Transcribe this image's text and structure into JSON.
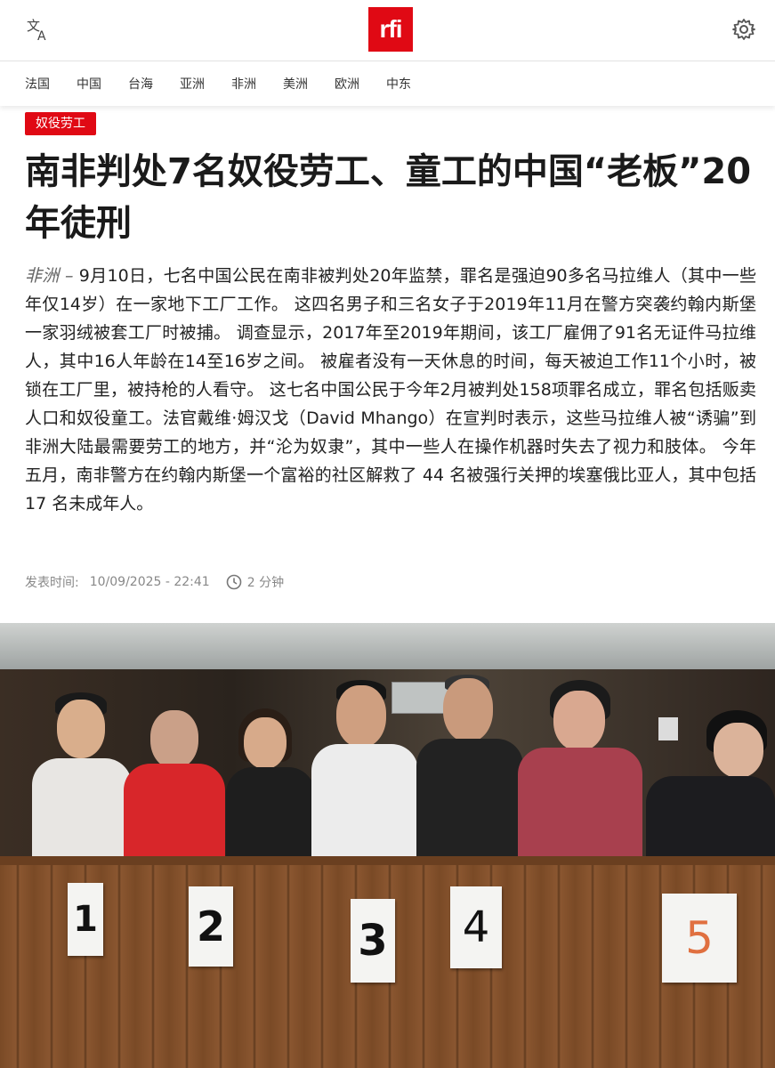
{
  "header": {
    "translate_icon": "translate-icon",
    "logo_text": "rfi",
    "settings_icon": "gear-icon"
  },
  "nav": {
    "items": [
      "法国",
      "中国",
      "台海",
      "亚洲",
      "非洲",
      "美洲",
      "欧洲",
      "中东"
    ]
  },
  "article": {
    "tag": "奴役劳工",
    "title": "南非判处7名奴役劳工、童工的中国“老板”20年徒刑",
    "region": "非洲",
    "region_sep": " – ",
    "lead": "9月10日，七名中国公民在南非被判处20年监禁，罪名是强迫90多名马拉维人（其中一些年仅14岁）在一家地下工厂工作。 这四名男子和三名女子于2019年11月在警方突袭约翰内斯堡一家羽绒被套工厂时被捕。 调查显示，2017年至2019年期间，该工厂雇佣了91名无证件马拉维人，其中16人年龄在14至16岁之间。 被雇者没有一天休息的时间，每天被迫工作11个小时，被锁在工厂里，被持枪的人看守。 这七名中国公民于今年2月被判处158项罪名成立，罪名包括贩卖人口和奴役童工。法官戴维·姆汉戈（David Mhango）在宣判时表示，这些马拉维人被“诱骗”到非洲大陆最需要劳工的地方，并“沦为奴隶”，其中一些人在操作机器时失去了视力和肢体。 今年五月，南非警方在约翰内斯堡一个富裕的社区解救了 44 名被强行关押的埃塞俄比亚人，其中包括 17 名未成年人。",
    "published_label": "发表时间:",
    "published_value": "10/09/2025 - 22:41",
    "read_time": "2 分钟",
    "clock_icon": "clock-icon"
  },
  "photo": {
    "signs": [
      "1",
      "2",
      "3",
      "4",
      "5"
    ]
  },
  "colors": {
    "brand_red": "#e00914"
  }
}
